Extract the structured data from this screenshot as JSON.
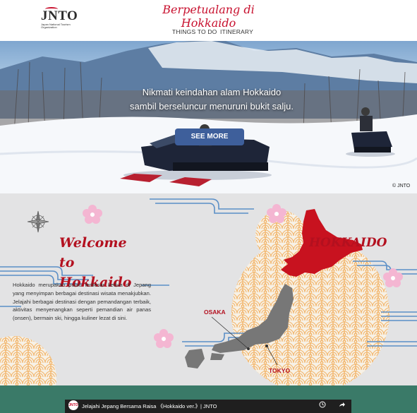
{
  "header": {
    "logo_mark": "JNTO",
    "logo_sub": "Japan National Tourism Organization",
    "site_title": "Berpetualang di Hokkaido",
    "nav": [
      "THINGS TO DO",
      "ITINERARY"
    ]
  },
  "hero": {
    "headline_line1": "Nikmati keindahan alam Hokkaido",
    "headline_line2": "sambil berseluncur menuruni bukit salju.",
    "button_label": "SEE MORE",
    "credit": "© JNTO"
  },
  "welcome": {
    "title_line1": "Welcome to",
    "title_line2": "Hokkaido",
    "body": "Hokkaido merupakan pulau terbesar kedua di Jepang yang menyimpan berbagai destinasi wisata menakjubkan. Jelajahi berbagai destinasi dengan pemandangan terbaik, aktivitas menyenangkan seperti pemandian air panas (onsen), bermain ski, hingga kuliner lezat di sini.",
    "map_region_label": "HOKKAIDO",
    "map_labels": {
      "osaka": "OSAKA",
      "tokyo": "TOKYO"
    }
  },
  "video": {
    "avatar_text": "JNTO",
    "title": "Jelajahi Jepang Bersama Raisa 《Hokkaido ver.》| JNTO"
  },
  "colors": {
    "brand_red": "#c8102e",
    "button_blue": "#3e5f9b",
    "section_grey": "#e3e3e4",
    "video_strip": "#3a7a68",
    "wave_blue": "#5b8fc7",
    "pattern_orange": "#f2b56b",
    "blossom_pink": "#f4b6d2"
  },
  "icons": [
    "compass-icon",
    "cherry-blossom-icon",
    "clock-icon",
    "share-icon"
  ]
}
